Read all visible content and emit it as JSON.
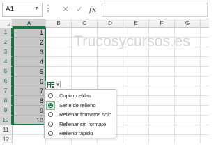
{
  "formula_bar": {
    "name_box": "A1",
    "cancel_icon": "close-icon",
    "enter_icon": "check-icon",
    "fx_label": "fx",
    "formula": ""
  },
  "columns": [
    "A",
    "B",
    "C",
    "D",
    "E",
    "F",
    "G",
    "H"
  ],
  "rows": [
    "1",
    "2",
    "3",
    "4",
    "5",
    "6",
    "7",
    "8",
    "9",
    "10",
    "11",
    "12"
  ],
  "cells": {
    "A": [
      "1",
      "2",
      "3",
      "4",
      "5",
      "6",
      "7",
      "8",
      "9",
      "10"
    ]
  },
  "watermark": "Trucosycursos.es",
  "autofill_options": {
    "button_icon": "autofill-options-icon",
    "items": [
      {
        "label": "Copiar celdas",
        "checked": false
      },
      {
        "label": "Serie de relleno",
        "checked": true
      },
      {
        "label": "Rellenar formatos solo",
        "checked": false
      },
      {
        "label": "Rellenar sin formato",
        "checked": false
      },
      {
        "label": "Relleno rápido",
        "checked": false
      }
    ]
  },
  "colors": {
    "selection_border": "#217346",
    "selection_fill": "#c6c6c6",
    "header_bg": "#f1f1f1"
  }
}
